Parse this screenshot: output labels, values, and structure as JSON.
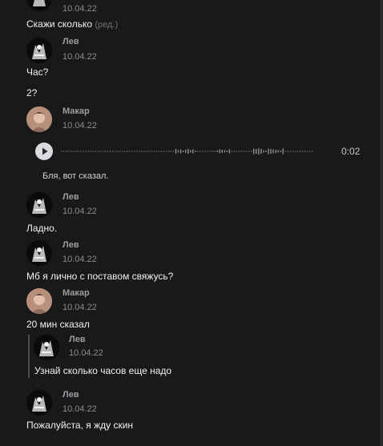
{
  "messages": [
    {
      "type": "continuation",
      "date": "10.04.22",
      "text": "Скажи сколько",
      "edited": "(ред.)"
    },
    {
      "type": "group",
      "author": "Лев",
      "avatar": "lev",
      "date": "10.04.22",
      "lines": [
        "Час?",
        "2?"
      ]
    },
    {
      "type": "voice",
      "author": "Макар",
      "avatar": "makar",
      "date": "10.04.22",
      "duration": "0:02",
      "transcript": "Бля, вот сказал.",
      "progress": 0
    },
    {
      "type": "group",
      "author": "Лев",
      "avatar": "lev",
      "date": "10.04.22",
      "lines": [
        "Ладно."
      ]
    },
    {
      "type": "group",
      "author": "Лев",
      "avatar": "lev",
      "date": "10.04.22",
      "lines": [
        "Мб я лично с поставом свяжусь?"
      ]
    },
    {
      "type": "group",
      "author": "Макар",
      "avatar": "makar",
      "date": "10.04.22",
      "lines": [
        "20 мин сказал"
      ],
      "quote": {
        "author": "Лев",
        "avatar": "lev",
        "date": "10.04.22",
        "text": "Узнай сколько часов еще надо"
      }
    },
    {
      "type": "group",
      "author": "Лев",
      "avatar": "lev",
      "date": "10.04.22",
      "lines": [
        "Пожалуйста, я жду скин"
      ]
    }
  ],
  "colors": {
    "background": "#19191a",
    "text": "#f0f1f2",
    "muted": "#8a8d91",
    "wave": "#8d9094"
  }
}
